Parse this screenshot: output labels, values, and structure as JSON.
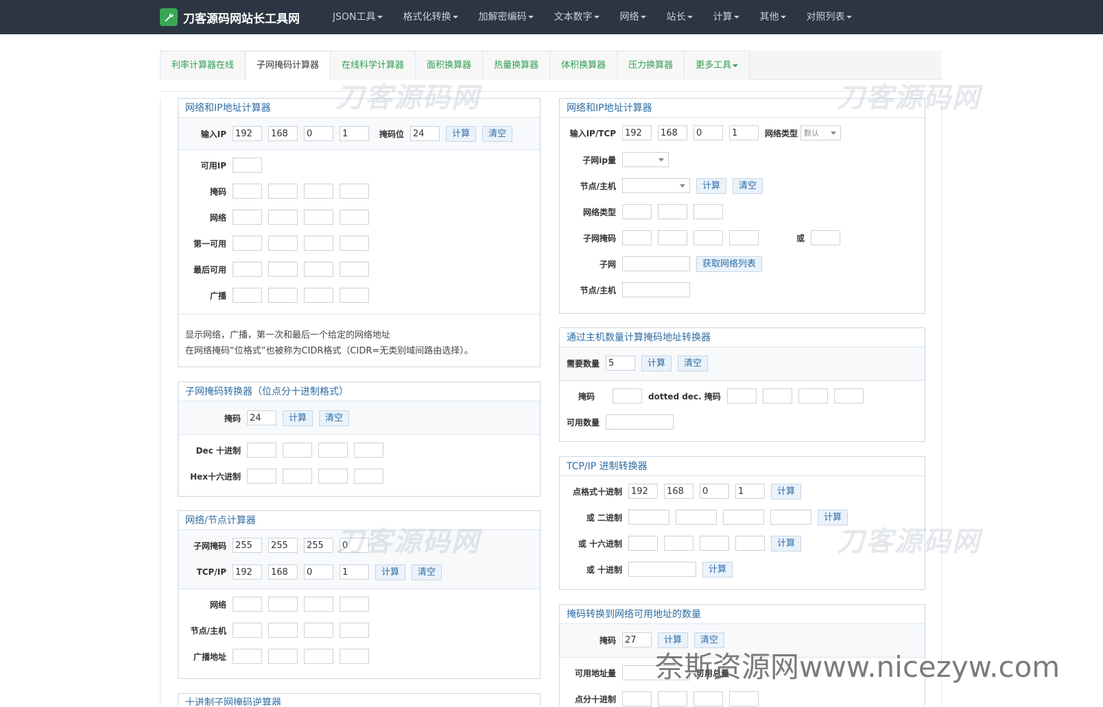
{
  "brand": {
    "name": "刀客源码网站长工具网",
    "icon": "wrench-icon",
    "accent": "#3aa655"
  },
  "nav": [
    "JSON工具",
    "格式化转换",
    "加解密编码",
    "文本数字",
    "网络",
    "站长",
    "计算",
    "其他",
    "对照列表"
  ],
  "tabs": [
    "利率计算器在线",
    "子网掩码计算器",
    "在线科学计算器",
    "面积换算器",
    "热量换算器",
    "体积换算器",
    "压力换算器",
    "更多工具"
  ],
  "watermark": "刀客源码网",
  "site_watermark": "奈斯资源网www.nicezyw.com",
  "common": {
    "calc": "计算",
    "clear": "清空"
  },
  "p1": {
    "title": "网络和IP地址计算器",
    "input_label": "输入IP",
    "ip": [
      "192",
      "168",
      "0",
      "1"
    ],
    "mask_label": "掩码位",
    "mask": "24",
    "avail_label": "可用IP",
    "rows": [
      "掩码",
      "网络",
      "第一可用",
      "最后可用",
      "广播"
    ],
    "note1": "显示网络，广播，第一次和最后一个给定的网络地址",
    "note2": "在网络掩码“位格式”也被称为CIDR格式（CIDR=无类别域间路由选择）。"
  },
  "p2": {
    "title": "子网掩码转换器（位点分十进制格式）",
    "mask_label": "掩码",
    "mask": "24",
    "dec_label": "Dec 十进制",
    "hex_label": "Hex十六进制"
  },
  "p3": {
    "title": "网络/节点计算器",
    "mask_label": "子网掩码",
    "mask": [
      "255",
      "255",
      "255",
      "0"
    ],
    "tcp_label": "TCP/IP",
    "ip": [
      "192",
      "168",
      "0",
      "1"
    ],
    "rows": [
      "网络",
      "节点/主机",
      "广播地址"
    ]
  },
  "p4": {
    "title": "十进制子网掩码逆算器"
  },
  "r1": {
    "title": "网络和IP地址计算器",
    "input_label": "输入IP/TCP",
    "ip": [
      "192",
      "168",
      "0",
      "1"
    ],
    "type_label": "网络类型",
    "type_value": "默认",
    "subnet_count_label": "子网ip量",
    "node_label": "节点/主机",
    "nettype_label": "网络类型",
    "submask_label": "子网掩码",
    "or_label": "或",
    "subnet_label": "子网",
    "get_list": "获取网络列表",
    "node2_label": "节点/主机"
  },
  "r2": {
    "title": "通过主机数量计算掩码地址转换器",
    "need_label": "需要数量",
    "need": "5",
    "mask_label": "掩码",
    "dotted_label": "dotted dec. 掩码",
    "avail_label": "可用数量"
  },
  "r3": {
    "title": "TCP/IP 进制转换器",
    "dotted_label": "点格式十进制",
    "ip": [
      "192",
      "168",
      "0",
      "1"
    ],
    "bin_label": "或 二进制",
    "hex_label": "或 十六进制",
    "dec_label": "或 十进制"
  },
  "r4": {
    "title": "掩码转换到网络可用地址的数量",
    "mask_label": "掩码",
    "mask": "27",
    "avail_label": "可用地址量",
    "total_label": "可用总量",
    "dotted_label": "点分十进制"
  }
}
